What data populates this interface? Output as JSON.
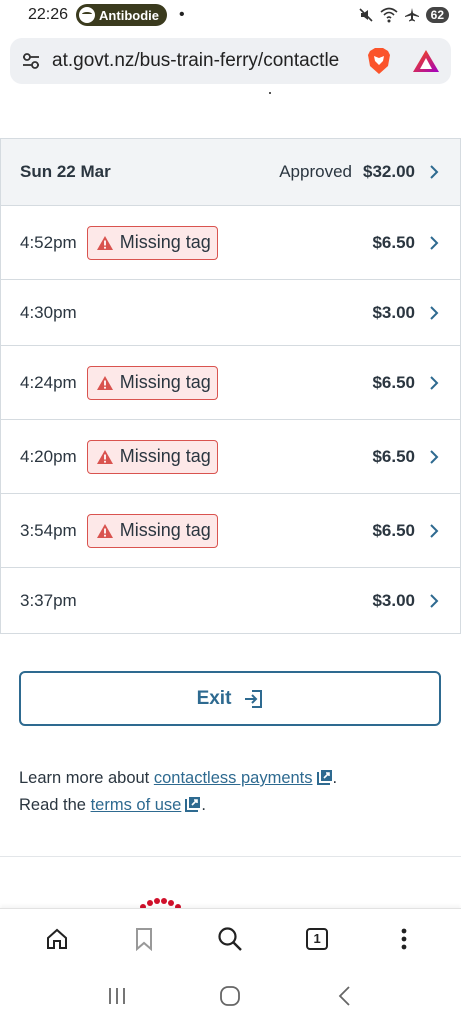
{
  "status_bar": {
    "time": "22:26",
    "notification_app": "Antibodie",
    "dot": "•",
    "battery": "62"
  },
  "url_bar": {
    "url": "at.govt.nz/bus-train-ferry/contactle"
  },
  "day": {
    "date": "Sun 22 Mar",
    "status": "Approved",
    "total": "$32.00"
  },
  "trips": [
    {
      "time": "4:52pm",
      "tag": "Missing tag",
      "fare": "$6.50"
    },
    {
      "time": "4:30pm",
      "tag": "",
      "fare": "$3.00"
    },
    {
      "time": "4:24pm",
      "tag": "Missing tag",
      "fare": "$6.50"
    },
    {
      "time": "4:20pm",
      "tag": "Missing tag",
      "fare": "$6.50"
    },
    {
      "time": "3:54pm",
      "tag": "Missing tag",
      "fare": "$6.50"
    },
    {
      "time": "3:37pm",
      "tag": "",
      "fare": "$3.00"
    }
  ],
  "exit_button": {
    "label": "Exit"
  },
  "info": {
    "line1_prefix": "Learn more about ",
    "line1_link": "contactless payments",
    "line1_suffix": ".",
    "line2_prefix": "Read the ",
    "line2_link": "terms of use",
    "line2_suffix": "."
  },
  "browser_bar": {
    "tab_count": "1"
  },
  "colors": {
    "accent": "#2e6a90",
    "warning": "#d9534f",
    "warning_bg": "#fde8e8",
    "header_bg": "#f2f4f6",
    "text": "#2b3640"
  },
  "icons": {
    "status": [
      "spotify-icon",
      "mute-icon",
      "wifi-icon",
      "airplane-icon",
      "battery-icon"
    ],
    "url_bar": [
      "site-settings-icon",
      "brave-shield-icon",
      "brave-rewards-icon"
    ],
    "browser_bar": [
      "home-icon",
      "bookmark-icon",
      "search-icon",
      "tabs-icon",
      "menu-icon"
    ],
    "android_nav": [
      "recent-apps-icon",
      "home-nav-icon",
      "back-icon"
    ]
  }
}
